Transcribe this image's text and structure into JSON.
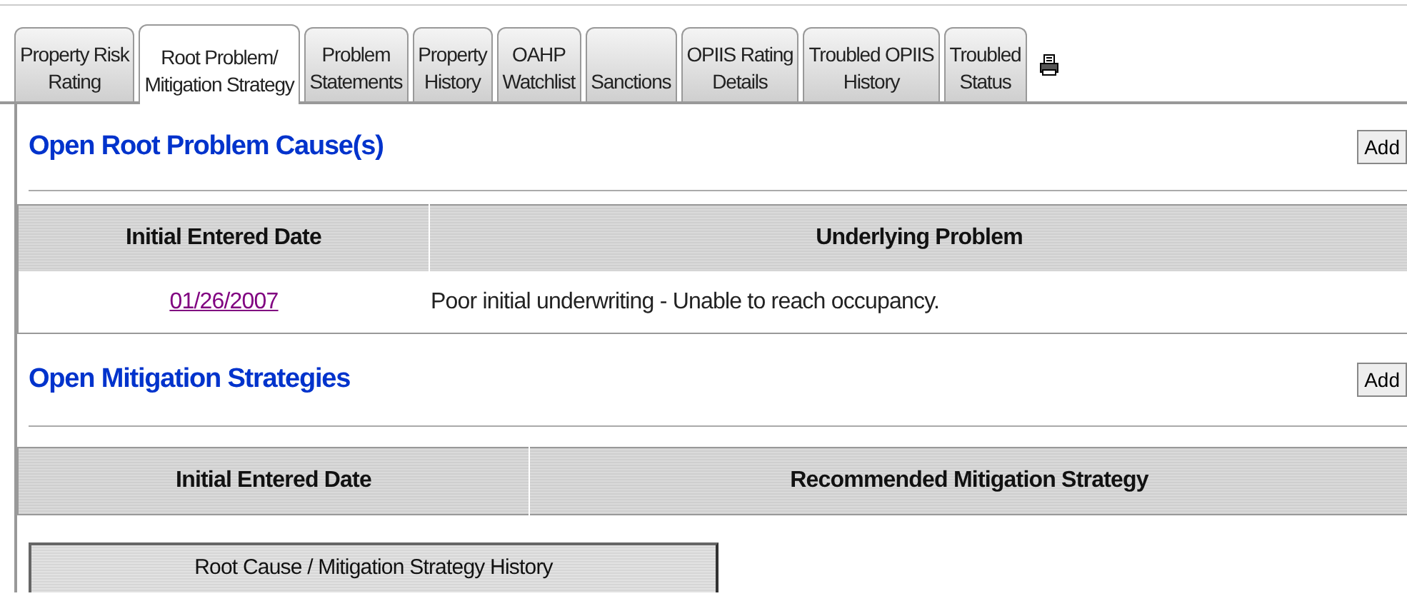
{
  "tabs": [
    {
      "lines": [
        "Property Risk",
        "Rating"
      ],
      "selected": false
    },
    {
      "lines": [
        "Root Problem/",
        "Mitigation Strategy"
      ],
      "selected": true
    },
    {
      "lines": [
        "Problem",
        "Statements"
      ],
      "selected": false
    },
    {
      "lines": [
        "Property",
        "History"
      ],
      "selected": false
    },
    {
      "lines": [
        "OAHP",
        "Watchlist"
      ],
      "selected": false
    },
    {
      "lines": [
        "Sanctions"
      ],
      "selected": false
    },
    {
      "lines": [
        "OPIIS Rating",
        "Details"
      ],
      "selected": false
    },
    {
      "lines": [
        "Troubled OPIIS",
        "History"
      ],
      "selected": false
    },
    {
      "lines": [
        "Troubled",
        "Status"
      ],
      "selected": false
    }
  ],
  "sections": [
    {
      "heading": "Open Root Problem Cause(s)",
      "button": "Add",
      "table": {
        "columns": [
          "Initial Entered Date",
          "Underlying Problem"
        ],
        "rows": [
          [
            {
              "kind": "link",
              "text": "01/26/2007"
            },
            {
              "kind": "text",
              "text": "Poor initial underwriting - Unable to reach occupancy."
            }
          ]
        ]
      }
    },
    {
      "heading": "Open Mitigation Strategies",
      "button": "Add",
      "table": {
        "columns": [
          "Initial Entered Date",
          "Recommended Mitigation Strategy"
        ]
      }
    }
  ],
  "history_button": "Root Cause / Mitigation Strategy History"
}
